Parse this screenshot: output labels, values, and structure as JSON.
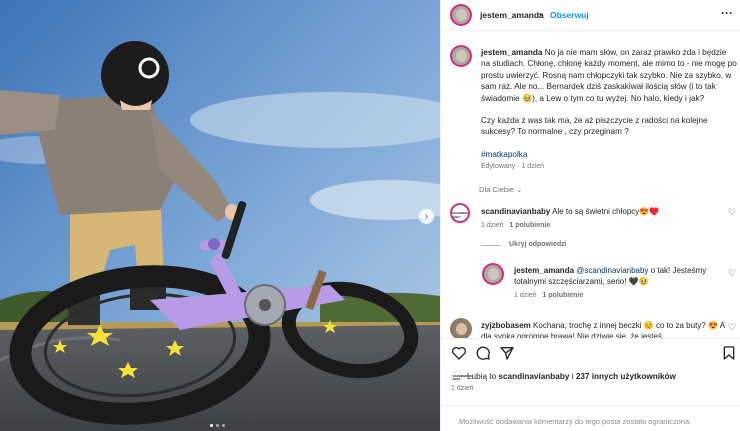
{
  "post": {
    "username": "jestem_amanda",
    "separator": "•",
    "follow_label": "Obserwuj",
    "more_icon": "more-horizontal-icon"
  },
  "caption": {
    "username": "jestem_amanda",
    "paragraph1": "No ja nie mam słów, on zaraz prawko zda i będzie na studiach. Chłonę, chłonę każdy moment, ale mimo to - nie mogę po prostu uwierzyć. Rosną nam chłopczyki tak szybko. Nie za szybko, w sam raz. Ale no... Bernardek dziś zaskakiwał ilością słów (i to tak świadomie 🥹), a Lew o tym co tu wyżej. No halo, kiedy i jak?",
    "paragraph2": "Czy każda z was tak ma, że aż piszczycie z radości na kolejne sukcesy? To normalne , czy przeginam ?",
    "hashtag": "#matkapolka",
    "edited": "Edytowany · 1 dzień"
  },
  "for_you": "Dla Ciebie ⌄",
  "comments": [
    {
      "username": "scandinavianbaby",
      "text": "Ale to są świetni chłopcy😍♥️",
      "time": "1 dzień",
      "likes": "1 polubienie",
      "avatar_text": "SCANDINAVIAN BABY"
    },
    {
      "hide_replies": "Ukryj odpowiedzi"
    },
    {
      "username": "jestem_amanda",
      "mention": "@scandinavianbaby",
      "text": "o tak! Jesteśmy totalnymi szczęściarzami, serio! 🖤🥹",
      "time": "1 dzień",
      "likes": "1 polubienie"
    },
    {
      "username": "zyjzbobasem",
      "text_line1": "Kochana, trochę z innej beczki 😊 co to za buty?",
      "text_line2": "😍 A dla synka ogromne brawa! Nie dziwie się, że jesteś"
    }
  ],
  "likes": {
    "prefix": "Lubią to",
    "user": "scandinavianbaby",
    "middle": "i",
    "others": "237 innych użytkowników",
    "avatar_text": "SCANDINAVIAN BABY"
  },
  "posted_time": "1 dzień",
  "footer": "Możliwość dodawania komentarzy do tego posta została ograniczona.",
  "carousel": {
    "next_glyph": "›",
    "dots": 3,
    "active_dot": 1
  },
  "colors": {
    "accent_blue": "#0095f6",
    "heart_red": "#ed4956",
    "muted": "#737373",
    "bike_lilac": "#b79be6",
    "sky": "#5a8cc4"
  }
}
